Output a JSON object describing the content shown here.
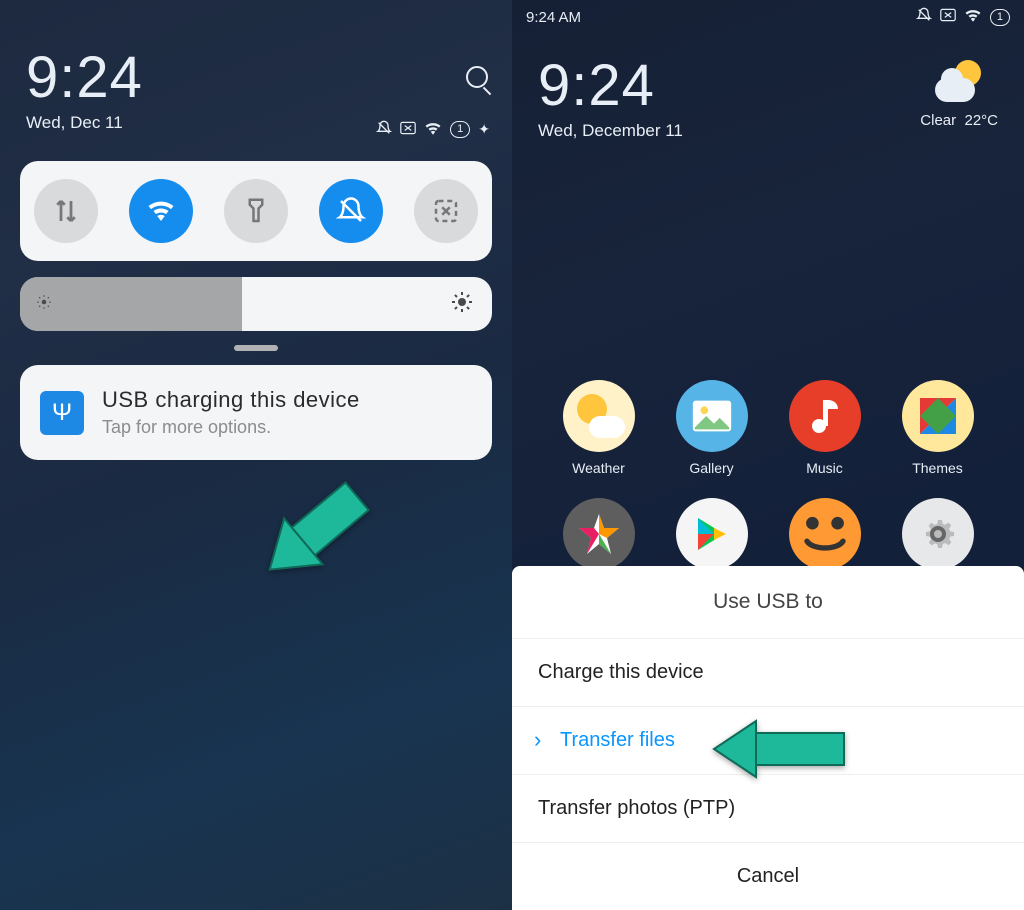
{
  "left": {
    "time": "9:24",
    "date": "Wed,  Dec 11",
    "status": {
      "battery": "1"
    },
    "toggles": [
      {
        "name": "mobile-data",
        "active": false
      },
      {
        "name": "wifi",
        "active": true
      },
      {
        "name": "flashlight",
        "active": false
      },
      {
        "name": "dnd",
        "active": true
      },
      {
        "name": "screenshot",
        "active": false
      }
    ],
    "notification": {
      "title": "USB  charging  this  device",
      "subtitle": "Tap for more options."
    }
  },
  "right": {
    "statusbar_time": "9:24 AM",
    "time": "9:24",
    "date": "Wed, December 11",
    "weather": {
      "condition": "Clear",
      "temp": "22°C"
    },
    "status": {
      "battery": "1"
    },
    "apps": [
      {
        "label": "Weather",
        "icon": "weather"
      },
      {
        "label": "Gallery",
        "icon": "gallery"
      },
      {
        "label": "Music",
        "icon": "music"
      },
      {
        "label": "Themes",
        "icon": "themes"
      },
      {
        "label": "",
        "icon": "star"
      },
      {
        "label": "",
        "icon": "play"
      },
      {
        "label": "",
        "icon": "smile"
      },
      {
        "label": "",
        "icon": "settings"
      }
    ],
    "usb_sheet": {
      "title": "Use USB to",
      "options": [
        {
          "label": "Charge this device",
          "selected": false
        },
        {
          "label": "Transfer files",
          "selected": true
        },
        {
          "label": "Transfer photos (PTP)",
          "selected": false
        }
      ],
      "cancel": "Cancel"
    }
  },
  "colors": {
    "accent": "#158def",
    "arrow": "#1eb89a"
  }
}
